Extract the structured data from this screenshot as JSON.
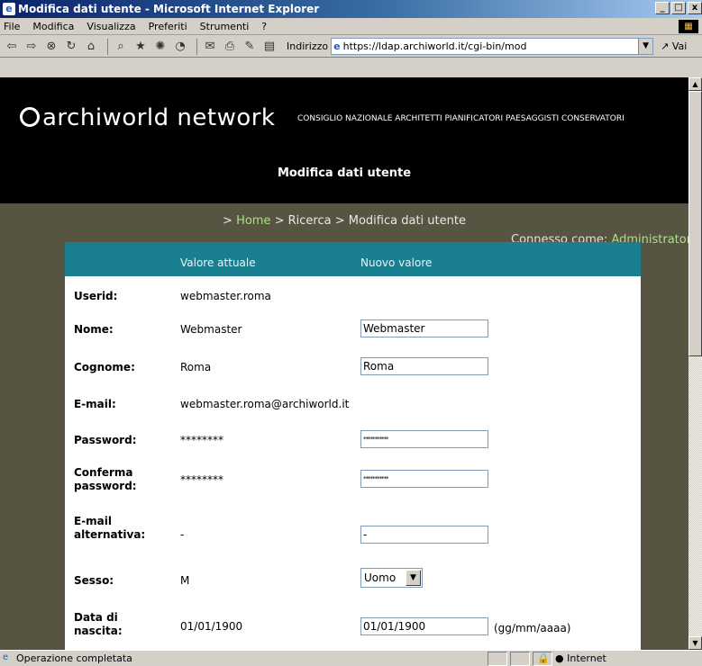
{
  "window": {
    "title": "Modifica dati utente - Microsoft Internet Explorer",
    "min": "_",
    "max": "□",
    "close": "x"
  },
  "menu": [
    "File",
    "Modifica",
    "Visualizza",
    "Preferiti",
    "Strumenti",
    "?"
  ],
  "address": {
    "label": "Indirizzo",
    "url": "https://ldap.archiworld.it/cgi-bin/mod",
    "go": "Vai"
  },
  "site": {
    "logo": "archiworld network",
    "subtitle": "CONSIGLIO NAZIONALE ARCHITETTI PIANIFICATORI PAESAGGISTI CONSERVATORI",
    "heading": "Modifica dati utente"
  },
  "breadcrumb": {
    "sep": ">",
    "home": "Home",
    "rest": "> Ricerca > Modifica dati utente"
  },
  "session": {
    "prefix": "Connesso come:",
    "user": "Administrator"
  },
  "table": {
    "col_current": "Valore attuale",
    "col_new": "Nuovo valore",
    "rows": [
      {
        "label": "Userid:",
        "current": "webmaster.roma"
      },
      {
        "label": "Nome:",
        "current": "Webmaster",
        "new": "Webmaster"
      },
      {
        "label": "Cognome:",
        "current": "Roma",
        "new": "Roma"
      },
      {
        "label": "E-mail:",
        "current": "webmaster.roma@archiworld.it"
      },
      {
        "label": "Password:",
        "current": "********",
        "new": "***********"
      },
      {
        "label": "Conferma password:",
        "current": "********",
        "new": "***********"
      },
      {
        "label": "E-mail alternativa:",
        "current": "-",
        "new": "-"
      },
      {
        "label": "Sesso:",
        "current": "M",
        "new": "Uomo"
      },
      {
        "label": "Data di nascita:",
        "current": "01/01/1900",
        "new": "01/01/1900",
        "hint": "(gg/mm/aaaa)"
      }
    ]
  },
  "status": {
    "text": "Operazione completata",
    "zone": "Internet"
  }
}
